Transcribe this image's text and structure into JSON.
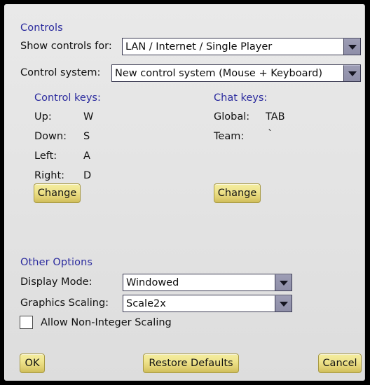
{
  "sections": {
    "controls": {
      "header": "Controls",
      "show_controls_label": "Show controls for:",
      "show_controls_value": "LAN / Internet / Single Player",
      "control_system_label": "Control system:",
      "control_system_value": "New control system (Mouse + Keyboard)"
    },
    "control_keys": {
      "header": "Control keys:",
      "rows": [
        {
          "label": "Up:",
          "value": "W"
        },
        {
          "label": "Down:",
          "value": "S"
        },
        {
          "label": "Left:",
          "value": "A"
        },
        {
          "label": "Right:",
          "value": "D"
        }
      ],
      "change_label": "Change"
    },
    "chat_keys": {
      "header": "Chat keys:",
      "rows": [
        {
          "label": "Global:",
          "value": "TAB"
        },
        {
          "label": "Team:",
          "value": "`"
        }
      ],
      "change_label": "Change"
    },
    "other_options": {
      "header": "Other Options",
      "display_mode_label": "Display Mode:",
      "display_mode_value": "Windowed",
      "graphics_scaling_label": "Graphics Scaling:",
      "graphics_scaling_value": "Scale2x",
      "non_integer_scaling_label": "Allow Non-Integer Scaling",
      "non_integer_scaling_checked": false
    }
  },
  "footer": {
    "ok_label": "OK",
    "restore_label": "Restore Defaults",
    "cancel_label": "Cancel"
  },
  "icons": {
    "dropdown": "chevron-down-icon"
  },
  "colors": {
    "header_blue": "#2b2b9e",
    "panel_bg": "#e4e4e4",
    "button_gold": "#efe48d",
    "combo_button": "#9c9cb4",
    "window_border": "#000000"
  }
}
